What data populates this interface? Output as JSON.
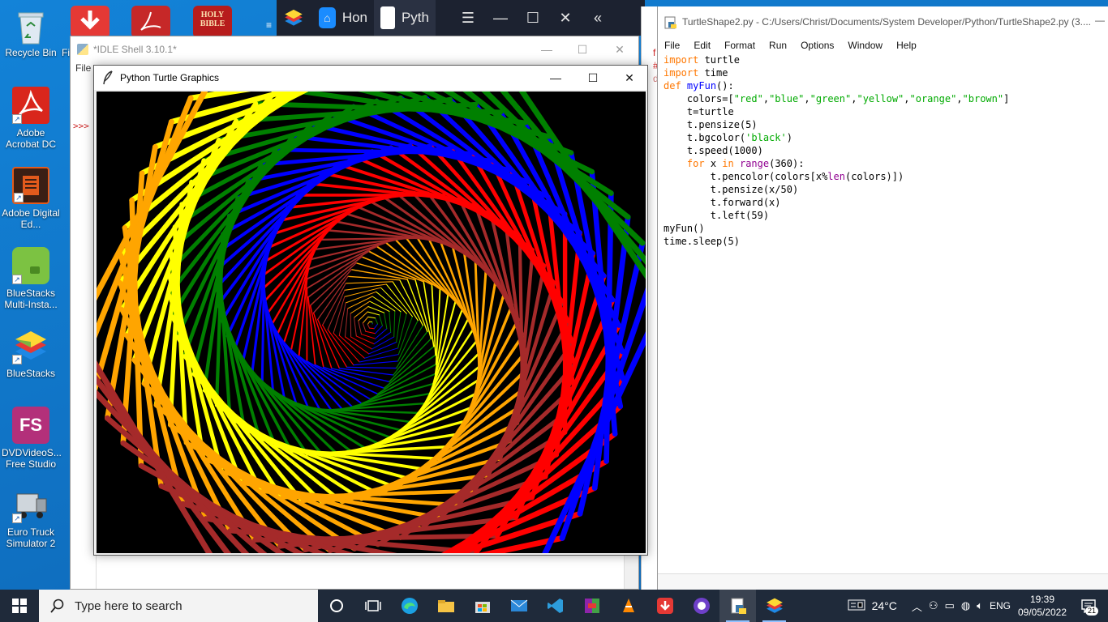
{
  "desktop": {
    "icons": [
      {
        "label": "Recycle Bin",
        "icon": "recycle-bin-icon"
      },
      {
        "label": "Adobe Acrobat DC",
        "icon": "acrobat-icon"
      },
      {
        "label": "Adobe Digital Ed...",
        "icon": "digital-editions-icon"
      },
      {
        "label": "BlueStacks Multi-Insta...",
        "icon": "bluestacks-multi-icon"
      },
      {
        "label": "BlueStacks",
        "icon": "bluestacks-icon"
      },
      {
        "label": "DVDVideoS... Free Studio",
        "icon": "dvdvideosoft-icon"
      },
      {
        "label": "Euro Truck Simulator 2",
        "icon": "euro-truck-icon"
      }
    ],
    "partial_label": "Fi",
    "holy_bible_label": "HOLY BIBLE",
    "fs_label": "FS"
  },
  "bluestacks_strip": {
    "tabs": [
      {
        "label": "Hon",
        "icon": "home-icon"
      },
      {
        "label": "Pyth",
        "icon": "python-app-icon"
      }
    ]
  },
  "idle_shell": {
    "title": "*IDLE Shell 3.10.1*",
    "menu_first": "File",
    "prompt": ">>>"
  },
  "turtle_window": {
    "title": "Python Turtle Graphics",
    "bgcolor": "black",
    "colors": [
      "red",
      "blue",
      "green",
      "yellow",
      "orange",
      "brown"
    ],
    "iterations": 360,
    "angle": 59
  },
  "editor": {
    "title": "TurtleShape2.py - C:/Users/Christ/Documents/System Developer/Python/TurtleShape2.py (3....",
    "menu": [
      "File",
      "Edit",
      "Format",
      "Run",
      "Options",
      "Window",
      "Help"
    ],
    "code": {
      "l1_kw": "import",
      "l1_rest": " turtle",
      "l2_kw": "import",
      "l2_rest": " time",
      "l3_kw": "def",
      "l3_fn": "myFun",
      "l3_rest": "():",
      "l4_a": "    colors=[",
      "l4_s1": "\"red\"",
      "l4_s2": "\"blue\"",
      "l4_s3": "\"green\"",
      "l4_s4": "\"yellow\"",
      "l4_s5": "\"orange\"",
      "l4_s6": "\"brown\"",
      "l4_end": "]",
      "l5": "    t=turtle",
      "l6": "    t.pensize(5)",
      "l7_a": "    t.bgcolor(",
      "l7_s": "'black'",
      "l7_b": ")",
      "l8": "    t.speed(1000)",
      "l9_ind": "    ",
      "l9_for": "for",
      "l9_x": " x ",
      "l9_in": "in",
      "l9_sp": " ",
      "l9_range": "range",
      "l9_rest": "(360):",
      "l10_a": "        t.pencolor(colors[x%",
      "l10_len": "len",
      "l10_b": "(colors)])",
      "l11": "        t.pensize(x/50)",
      "l12": "        t.forward(x)",
      "l13": "        t.left(59)",
      "l14": "myFun()",
      "l15": "time.sleep(5)"
    }
  },
  "taskbar": {
    "search_placeholder": "Type here to search",
    "temperature": "24°C",
    "language": "ENG",
    "time": "19:39",
    "date": "09/05/2022",
    "notification_count": "21"
  }
}
